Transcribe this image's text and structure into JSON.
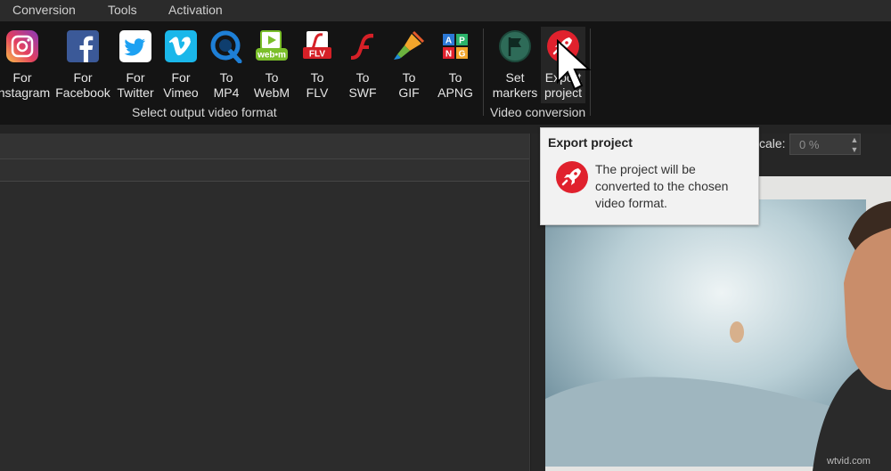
{
  "menu": [
    "Conversion",
    "Tools",
    "Activation"
  ],
  "ribbon": {
    "buttons": [
      {
        "name": "instagram",
        "label": "For\nInstagram",
        "icon": "instagram-icon"
      },
      {
        "name": "facebook",
        "label": "For\nFacebook",
        "icon": "facebook-icon"
      },
      {
        "name": "twitter",
        "label": "For\nTwitter",
        "icon": "twitter-icon"
      },
      {
        "name": "vimeo",
        "label": "For\nVimeo",
        "icon": "vimeo-icon"
      },
      {
        "name": "mp4",
        "label": "To\nMP4",
        "icon": "mp4-icon"
      },
      {
        "name": "webm",
        "label": "To\nWebM",
        "icon": "webm-icon"
      },
      {
        "name": "flv",
        "label": "To\nFLV",
        "icon": "flv-icon"
      },
      {
        "name": "swf",
        "label": "To\nSWF",
        "icon": "swf-icon"
      },
      {
        "name": "gif",
        "label": "To\nGIF",
        "icon": "gif-icon"
      },
      {
        "name": "apng",
        "label": "To\nAPNG",
        "icon": "apng-icon"
      },
      {
        "name": "set-markers",
        "label": "Set\nmarkers",
        "icon": "flag-icon"
      },
      {
        "name": "export-project",
        "label": "Export\nproject",
        "icon": "rocket-icon"
      }
    ],
    "group_output": "Select output video format",
    "group_conversion": "Video conversion",
    "webm_text": "web•m",
    "flv_text": "FLV",
    "apng_letters": [
      "A",
      "P",
      "N",
      "G"
    ]
  },
  "scale": {
    "label": "cale:",
    "value": "0 %"
  },
  "tooltip": {
    "title": "Export project",
    "text": "The project will be converted to the chosen video format."
  },
  "watermark": "wtvid.com",
  "colors": {
    "accent_red": "#e0212d",
    "ribbon_bg": "#141414"
  }
}
